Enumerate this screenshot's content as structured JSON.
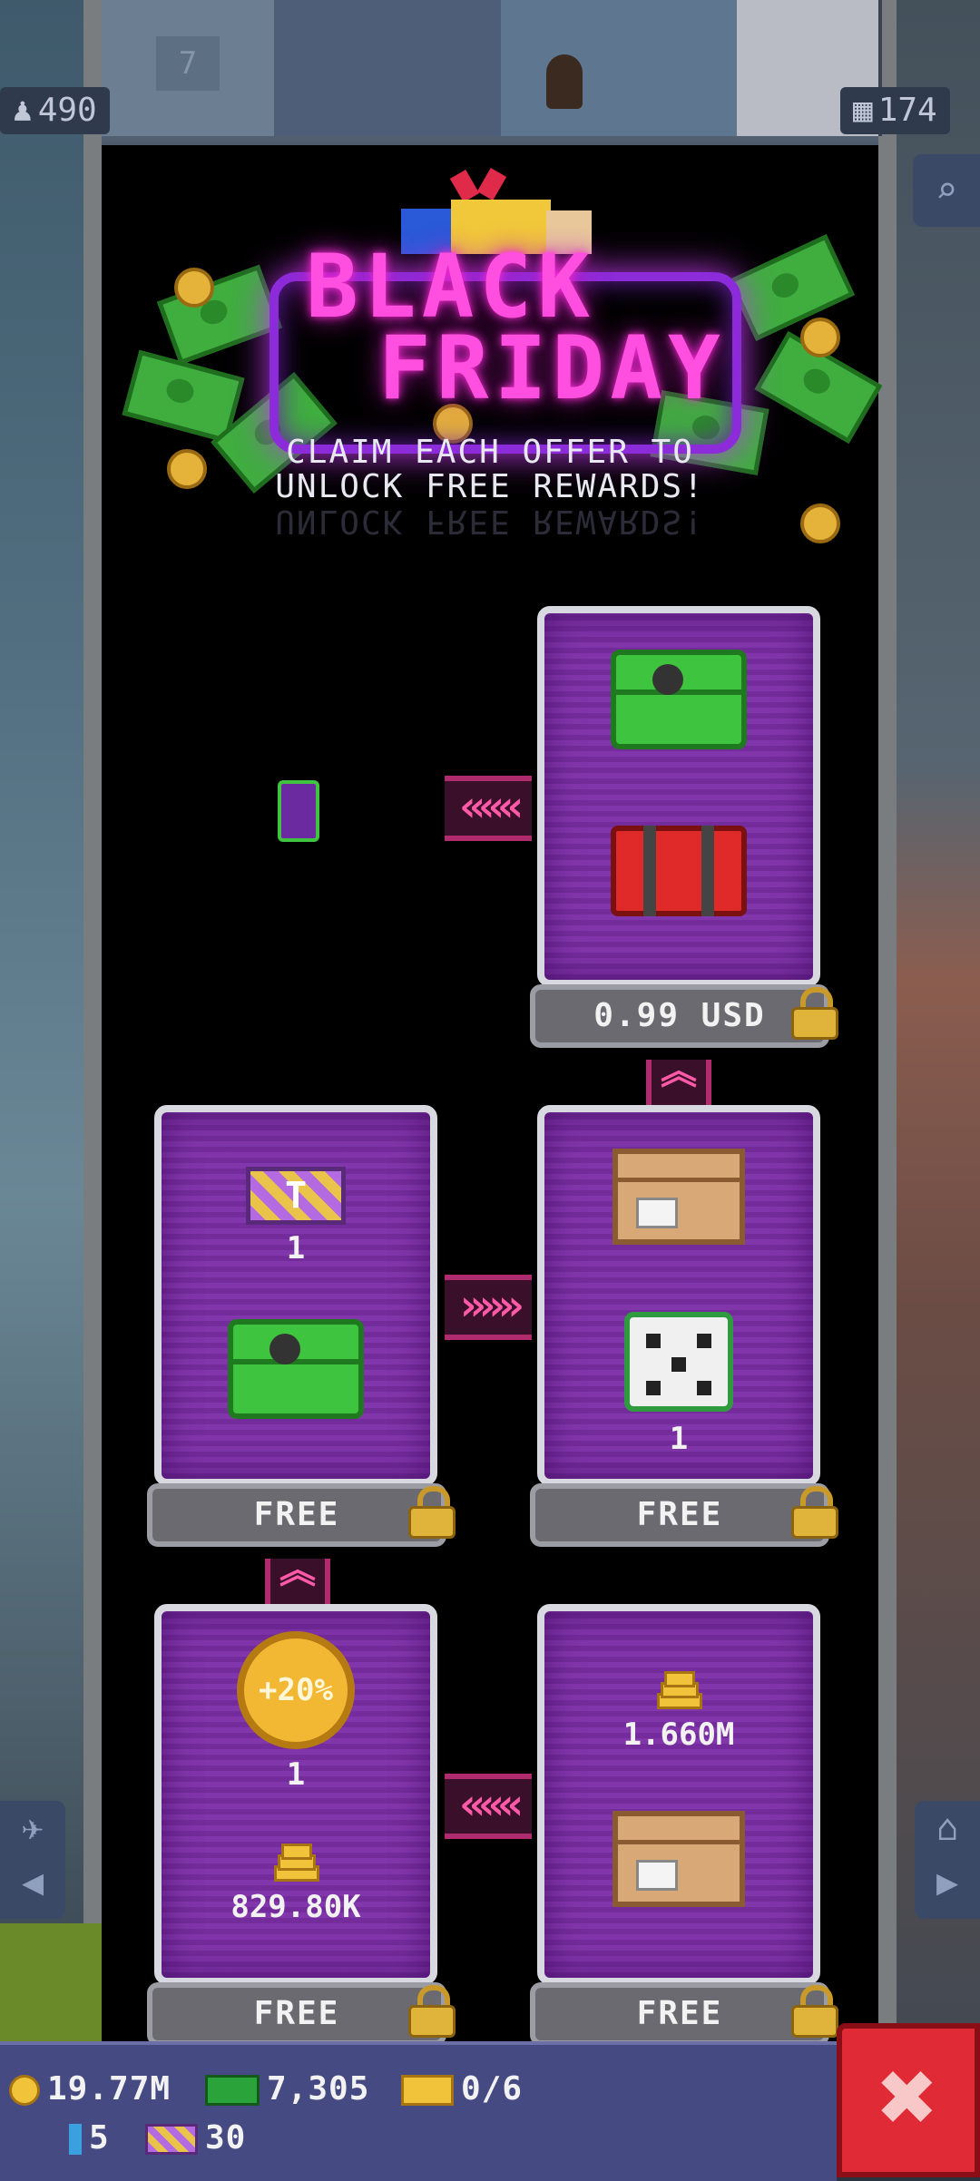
{
  "hud": {
    "population": "490",
    "floors": "174",
    "elevator_floor": "7"
  },
  "banner": {
    "title_line1": "BLACK",
    "title_line2": "FRIDAY",
    "subtitle_line1": "CLAIM EACH OFFER TO",
    "subtitle_line2": "UNLOCK FREE REWARDS!"
  },
  "cards": [
    {
      "id": "paid-offer",
      "price": "0.99 USD",
      "items": [
        "green-chest",
        "red-chest"
      ]
    },
    {
      "id": "free-left-1",
      "price": "FREE",
      "items": [
        {
          "icon": "ticket",
          "qty": "1"
        },
        {
          "icon": "green-chest"
        }
      ]
    },
    {
      "id": "free-right-1",
      "price": "FREE",
      "items": [
        {
          "icon": "crate"
        },
        {
          "icon": "dice",
          "qty": "1"
        }
      ]
    },
    {
      "id": "free-left-2",
      "price": "FREE",
      "items": [
        {
          "icon": "bonus-coin",
          "label": "+20%",
          "qty": "1"
        },
        {
          "icon": "coin-stack",
          "qty": "829.80K"
        }
      ]
    },
    {
      "id": "free-right-2",
      "price": "FREE",
      "items": [
        {
          "icon": "coin-stack",
          "qty": "1.660M"
        },
        {
          "icon": "crate"
        }
      ]
    }
  ],
  "resources": {
    "coins": "19.77M",
    "bux": "7,305",
    "tickets": "0/6",
    "keys": "5",
    "golden_tickets": "30"
  },
  "colors": {
    "accent_pink": "#ff4fe0",
    "card_purple": "#7e2fa8",
    "close_red": "#e02a36"
  }
}
